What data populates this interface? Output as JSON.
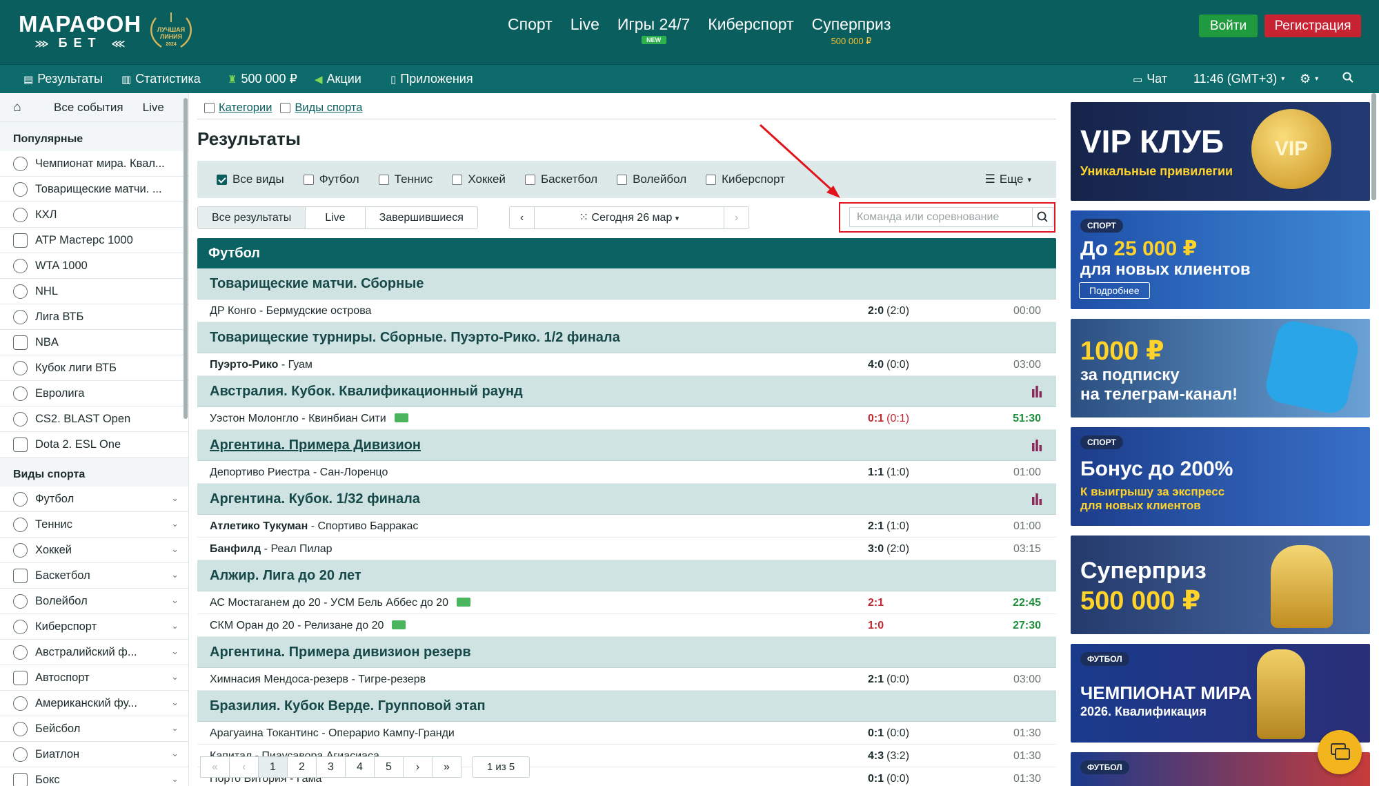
{
  "header": {
    "logo_main": "МАРАФОН",
    "logo_sub": "БЕТ",
    "award_text": "ЛУЧШАЯ ЛИНИЯ",
    "award_year": "2024",
    "nav": [
      {
        "label": "Спорт"
      },
      {
        "label": "Live"
      },
      {
        "label": "Игры 24/7",
        "badge": "NEW"
      },
      {
        "label": "Киберспорт"
      },
      {
        "label": "Суперприз",
        "sub": "500 000 ₽"
      }
    ],
    "login": "Войти",
    "register": "Регистрация"
  },
  "subbar": {
    "results": "Результаты",
    "stats": "Статистика",
    "prize": "500 000 ₽",
    "promo": "Акции",
    "apps": "Приложения",
    "chat": "Чат",
    "time": "11:46 (GMT+3)"
  },
  "sidebar": {
    "top_links": [
      "Все события",
      "Live"
    ],
    "popular_title": "Популярные",
    "popular": [
      "Чемпионат мира. Квал...",
      "Товарищеские матчи. ...",
      "КХЛ",
      "ATP Мастерс 1000",
      "WTA 1000",
      "NHL",
      "Лига ВТБ",
      "NBA",
      "Кубок лиги ВТБ",
      "Евролига",
      "CS2. BLAST Open",
      "Dota 2. ESL One"
    ],
    "sports_title": "Виды спорта",
    "sports": [
      "Футбол",
      "Теннис",
      "Хоккей",
      "Баскетбол",
      "Волейбол",
      "Киберспорт",
      "Австралийский ф...",
      "Автоспорт",
      "Американский фу...",
      "Бейсбол",
      "Биатлон",
      "Бокс"
    ]
  },
  "main": {
    "crumbs": [
      "Категории",
      "Виды спорта"
    ],
    "title": "Результаты",
    "filters": [
      "Все виды",
      "Футбол",
      "Теннис",
      "Хоккей",
      "Баскетбол",
      "Волейбол",
      "Киберспорт"
    ],
    "more": "Еще",
    "tabs": [
      "Все результаты",
      "Live",
      "Завершившиеся"
    ],
    "date": "Сегодня 26 мар",
    "search_placeholder": "Команда или соревнование",
    "sport_header": "Футбол",
    "groups": [
      {
        "title": "Товарищеские матчи. Сборные",
        "matches": [
          {
            "home": "ДР Конго",
            "away": "Бермудские острова",
            "score": "2:0",
            "ht": "(2:0)",
            "time": "00:00"
          }
        ]
      },
      {
        "title": "Товарищеские турниры. Сборные. Пуэрто-Рико. 1/2 финала",
        "matches": [
          {
            "home": "Пуэрто-Рико",
            "away": "Гуам",
            "score": "4:0",
            "ht": "(0:0)",
            "time": "03:00",
            "winner": "home"
          }
        ]
      },
      {
        "title": "Австралия. Кубок. Квалификационный раунд",
        "stats": true,
        "matches": [
          {
            "home": "Уэстон Молонгло",
            "away": "Квинбиан Сити",
            "score": "0:1",
            "ht": "(0:1)",
            "time": "51:30",
            "live": true,
            "video": true
          }
        ]
      },
      {
        "title": "Аргентина. Примера Дивизион",
        "stats": true,
        "link": true,
        "matches": [
          {
            "home": "Депортиво Риестра",
            "away": "Сан-Лоренцо",
            "score": "1:1",
            "ht": "(1:0)",
            "time": "01:00"
          }
        ]
      },
      {
        "title": "Аргентина. Кубок. 1/32 финала",
        "stats": true,
        "matches": [
          {
            "home": "Атлетико Тукуман",
            "away": "Спортиво Барракас",
            "score": "2:1",
            "ht": "(1:0)",
            "time": "01:00",
            "winner": "home"
          },
          {
            "home": "Банфилд",
            "away": "Реал Пилар",
            "score": "3:0",
            "ht": "(2:0)",
            "time": "03:15",
            "winner": "home"
          }
        ]
      },
      {
        "title": "Алжир. Лига до 20 лет",
        "matches": [
          {
            "home": "АС Мостаганем до 20",
            "away": "УСМ Бель Аббес до 20",
            "score": "2:1",
            "ht": "",
            "time": "22:45",
            "live": true,
            "video": true
          },
          {
            "home": "СКМ Оран до 20",
            "away": "Релизане до 20",
            "score": "1:0",
            "ht": "",
            "time": "27:30",
            "live": true,
            "video": true
          }
        ]
      },
      {
        "title": "Аргентина. Примера дивизион резерв",
        "matches": [
          {
            "home": "Химнасия Мендоса-резерв",
            "away": "Тигре-резерв",
            "score": "2:1",
            "ht": "(0:0)",
            "time": "03:00"
          }
        ]
      },
      {
        "title": "Бразилия. Кубок Верде. Групповой этап",
        "matches": [
          {
            "home": "Арагуаина Токантинс",
            "away": "Операрио Кампу-Гранди",
            "score": "0:1",
            "ht": "(0:0)",
            "time": "01:30"
          },
          {
            "home": "Капитал",
            "away": "Пиаусавора Агиасиаса",
            "score": "4:3",
            "ht": "(3:2)",
            "time": "01:30"
          },
          {
            "home": "Порто Витория",
            "away": "Гама",
            "score": "0:1",
            "ht": "(0:0)",
            "time": "01:30"
          }
        ]
      }
    ],
    "pager": {
      "pages": [
        "1",
        "2",
        "3",
        "4",
        "5"
      ],
      "info": "1 из 5"
    }
  },
  "banners": [
    {
      "title": "VIP КЛУБ",
      "sub": "Уникальные привилегии",
      "emblem": "VIP"
    },
    {
      "tag": "СПОРТ",
      "line1a": "До ",
      "line1b": "25 000 ₽",
      "line2": "для новых клиентов",
      "button": "Подробнее"
    },
    {
      "line1": "1000 ₽",
      "line2": "за подписку",
      "line3": "на телеграм-канал!"
    },
    {
      "tag": "СПОРТ",
      "line1": "Бонус до 200%",
      "line2": "К выигрышу за экспресс",
      "line3": "для новых клиентов"
    },
    {
      "line1": "Суперприз",
      "line2": "500 000 ₽"
    },
    {
      "tag": "ФУТБОЛ",
      "line1": "ЧЕМПИОНАТ МИРА",
      "line2": "2026. Квалификация"
    },
    {
      "tag": "ФУТБОЛ"
    }
  ],
  "colors": {
    "primary": "#0b5e5e",
    "login": "#1f9a3e",
    "register": "#c82333",
    "highlight": "#e1141d",
    "live_score": "#c0282f",
    "live_time": "#1d8f3a"
  }
}
